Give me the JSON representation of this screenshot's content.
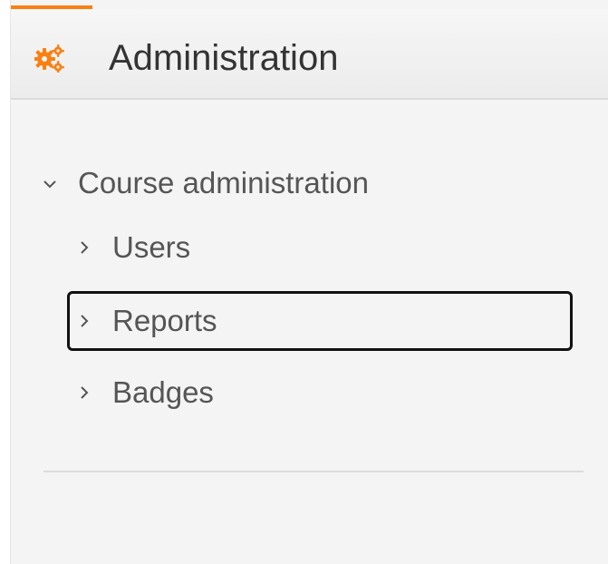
{
  "block": {
    "title": "Administration",
    "icon": "gears-icon",
    "accent_color": "#f98012"
  },
  "tree": {
    "course": {
      "label": "Course administration",
      "expanded": true,
      "icon": "chevron-down-icon"
    },
    "children": [
      {
        "label": "Users",
        "icon": "chevron-right-icon",
        "focused": false
      },
      {
        "label": "Reports",
        "icon": "chevron-right-icon",
        "focused": true
      },
      {
        "label": "Badges",
        "icon": "chevron-right-icon",
        "focused": false
      }
    ]
  }
}
